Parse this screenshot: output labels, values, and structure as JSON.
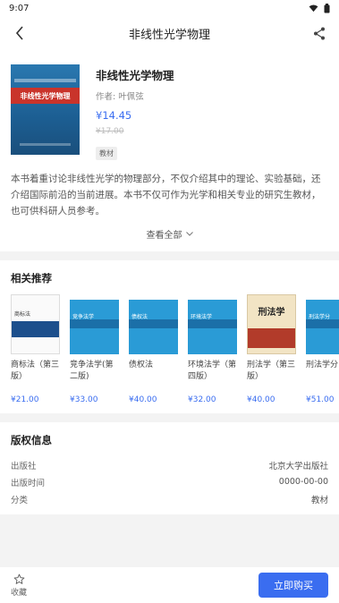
{
  "status": {
    "time": "9:07"
  },
  "header": {
    "title": "非线性光学物理"
  },
  "book": {
    "title": "非线性光学物理",
    "author": "作者: 叶佩弦",
    "price": "¥14.45",
    "original_price": "¥17.00",
    "tag": "教材",
    "cover_text": "非线性光学物理",
    "description": "本书着重讨论非线性光学的物理部分，不仅介绍其中的理论、实验基础，还介绍国际前沿的当前进展。本书不仅可作为光学和相关专业的研究生教材，也可供科研人员参考。",
    "expand_label": "查看全部"
  },
  "recommend": {
    "title": "相关推荐",
    "items": [
      {
        "name": "商标法（第三版）",
        "price": "¥21.00",
        "cover_style": "white",
        "cover_text": "商标法"
      },
      {
        "name": "竞争法学(第二版)",
        "price": "¥33.00",
        "cover_style": "blue",
        "cover_text": "竞争法学"
      },
      {
        "name": "债权法",
        "price": "¥40.00",
        "cover_style": "blue",
        "cover_text": "债权法"
      },
      {
        "name": "环境法学（第四版）",
        "price": "¥32.00",
        "cover_style": "blue",
        "cover_text": "环境法学"
      },
      {
        "name": "刑法学（第三版）",
        "price": "¥40.00",
        "cover_style": "cream",
        "cover_text": "刑法学"
      },
      {
        "name": "刑法学分",
        "price": "¥51.00",
        "cover_style": "blue",
        "cover_text": "刑法学分"
      }
    ]
  },
  "copyright": {
    "title": "版权信息",
    "rows": [
      {
        "label": "出版社",
        "value": "北京大学出版社"
      },
      {
        "label": "出版时间",
        "value": "0000-00-00"
      },
      {
        "label": "分类",
        "value": "教材"
      }
    ]
  },
  "footer": {
    "favorite_label": "收藏",
    "buy_label": "立即购买"
  },
  "colors": {
    "accent": "#3a6df0"
  }
}
